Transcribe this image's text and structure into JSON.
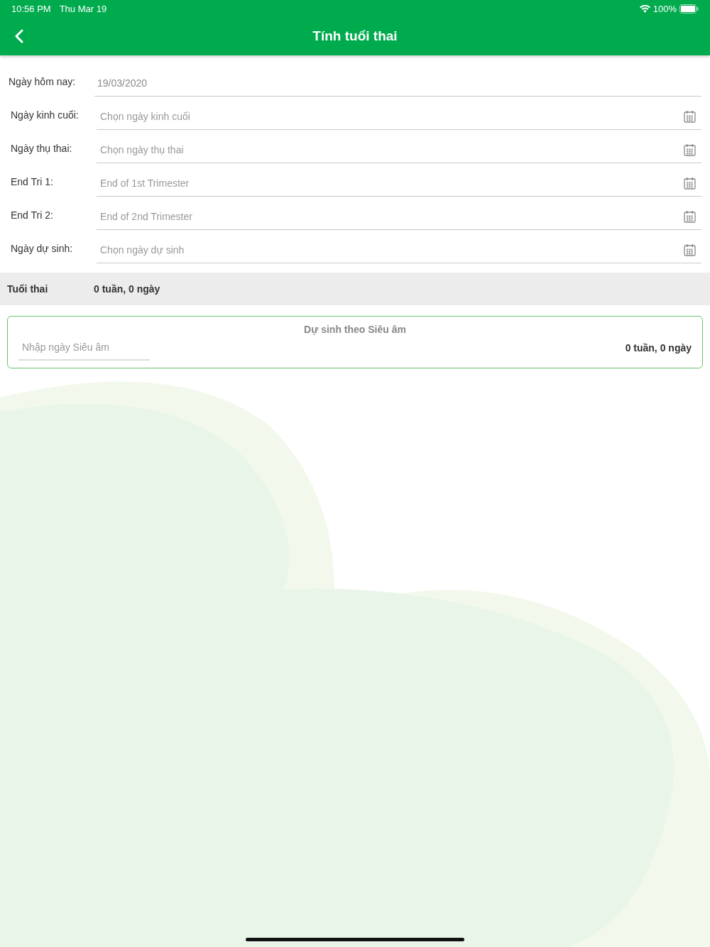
{
  "status_bar": {
    "time": "10:56 PM",
    "date": "Thu Mar 19",
    "battery": "100%"
  },
  "nav": {
    "title": "Tính tuổi thai"
  },
  "today": {
    "label": "Ngày hôm nay:",
    "value": "19/03/2020"
  },
  "date_fields": [
    {
      "label": "Ngày kinh cuối:",
      "placeholder": "Chọn ngày kinh cuối"
    },
    {
      "label": "Ngày thụ thai:",
      "placeholder": "Chọn ngày thụ thai"
    },
    {
      "label": "End Tri 1:",
      "placeholder": "End of 1st Trimester"
    },
    {
      "label": "End Tri 2:",
      "placeholder": "End of 2nd Trimester"
    },
    {
      "label": "Ngày dự sinh:",
      "placeholder": "Chọn ngày dự sinh"
    }
  ],
  "summary": {
    "label": "Tuổi thai",
    "value": "0 tuần, 0 ngày"
  },
  "ultrasound": {
    "title": "Dự sinh theo Siêu âm",
    "placeholder": "Nhập ngày Siêu âm",
    "result": "0 tuần, 0 ngày"
  }
}
